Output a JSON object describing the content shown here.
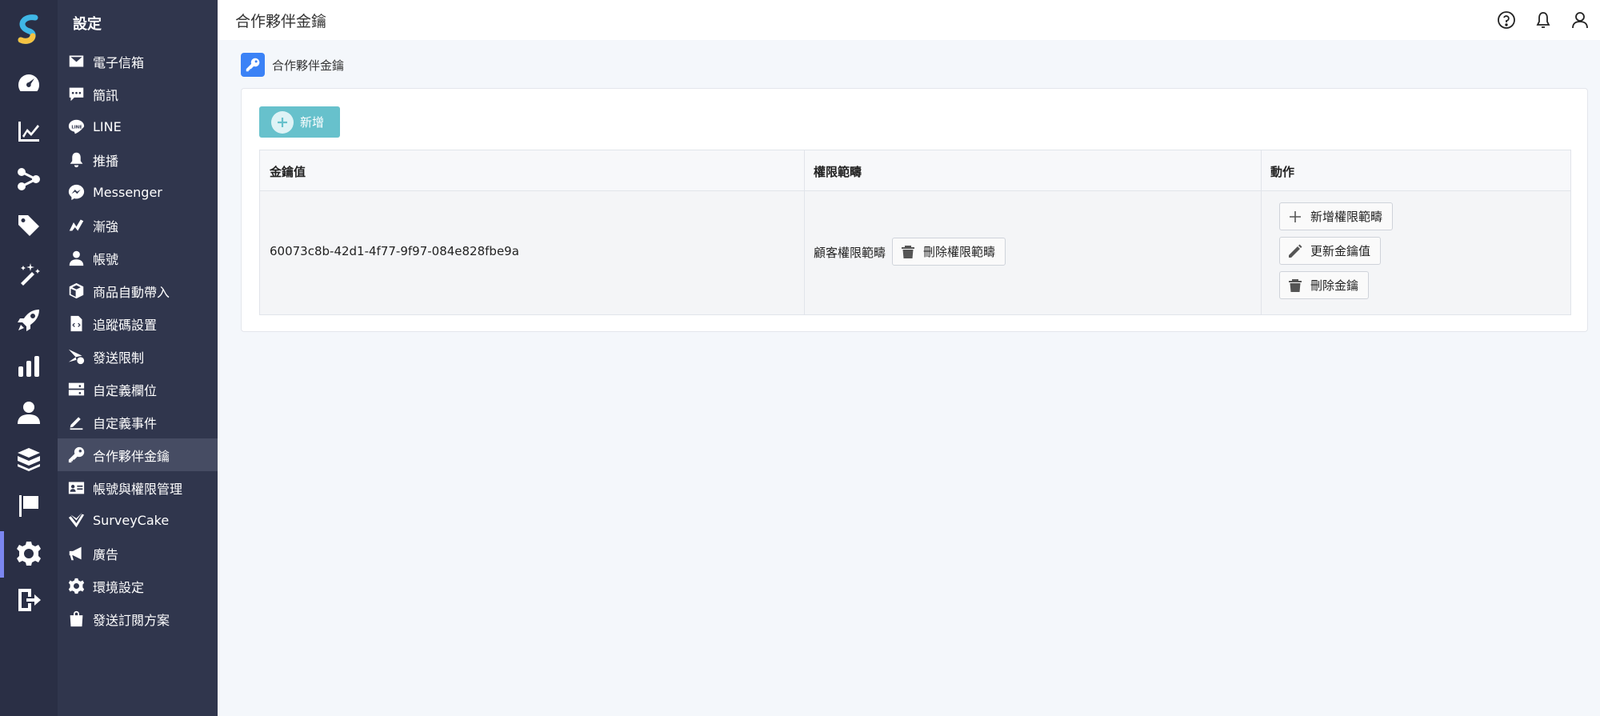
{
  "sidebar": {
    "title": "設定",
    "items": [
      {
        "label": "電子信箱",
        "icon": "envelope-icon"
      },
      {
        "label": "簡訊",
        "icon": "chat-icon"
      },
      {
        "label": "LINE",
        "icon": "line-icon"
      },
      {
        "label": "推播",
        "icon": "bell-icon"
      },
      {
        "label": "Messenger",
        "icon": "messenger-icon"
      },
      {
        "label": "漸強",
        "icon": "crescendo-icon"
      },
      {
        "label": "帳號",
        "icon": "user-icon"
      },
      {
        "label": "商品自動帶入",
        "icon": "box-icon"
      },
      {
        "label": "追蹤碼設置",
        "icon": "code-file-icon"
      },
      {
        "label": "發送限制",
        "icon": "send-limit-icon"
      },
      {
        "label": "自定義欄位",
        "icon": "server-icon"
      },
      {
        "label": "自定義事件",
        "icon": "pen-icon"
      },
      {
        "label": "合作夥伴金鑰",
        "icon": "key-icon"
      },
      {
        "label": "帳號與權限管理",
        "icon": "id-card-icon"
      },
      {
        "label": "SurveyCake",
        "icon": "surveycake-icon"
      },
      {
        "label": "廣告",
        "icon": "megaphone-icon"
      },
      {
        "label": "環境設定",
        "icon": "gear-icon"
      },
      {
        "label": "發送訂閱方案",
        "icon": "shopping-bag-icon"
      }
    ],
    "active_index": 12
  },
  "rail": {
    "icons": [
      "dashboard-icon",
      "line-chart-icon",
      "share-icon",
      "tag-icon",
      "magic-wand-icon",
      "rocket-icon",
      "bar-chart-icon",
      "person-icon",
      "boxes-icon",
      "flag-icon",
      "settings-icon",
      "logout-icon"
    ],
    "active_icon": "settings-icon"
  },
  "header": {
    "title": "合作夥伴金鑰",
    "icons": [
      "help-icon",
      "notification-bell-icon",
      "account-icon"
    ]
  },
  "breadcrumb": {
    "label": "合作夥伴金鑰"
  },
  "toolbar": {
    "add_label": "新增"
  },
  "table": {
    "columns": [
      "金鑰值",
      "權限範疇",
      "動作"
    ],
    "rows": [
      {
        "key_value": "60073c8b-42d1-4f77-9f97-084e828fbe9a",
        "scope_label": "顧客權限範疇",
        "delete_scope_label": "刪除權限範疇",
        "actions": {
          "add_scope": "新增權限範疇",
          "update_key": "更新金鑰值",
          "delete_key": "刪除金鑰"
        }
      }
    ]
  },
  "colors": {
    "rail_bg": "#2a2f45",
    "menu_bg": "#30364d",
    "accent": "#67c1cc",
    "active_bar": "#7b86f0",
    "crumb_icon": "#3b82f6"
  }
}
